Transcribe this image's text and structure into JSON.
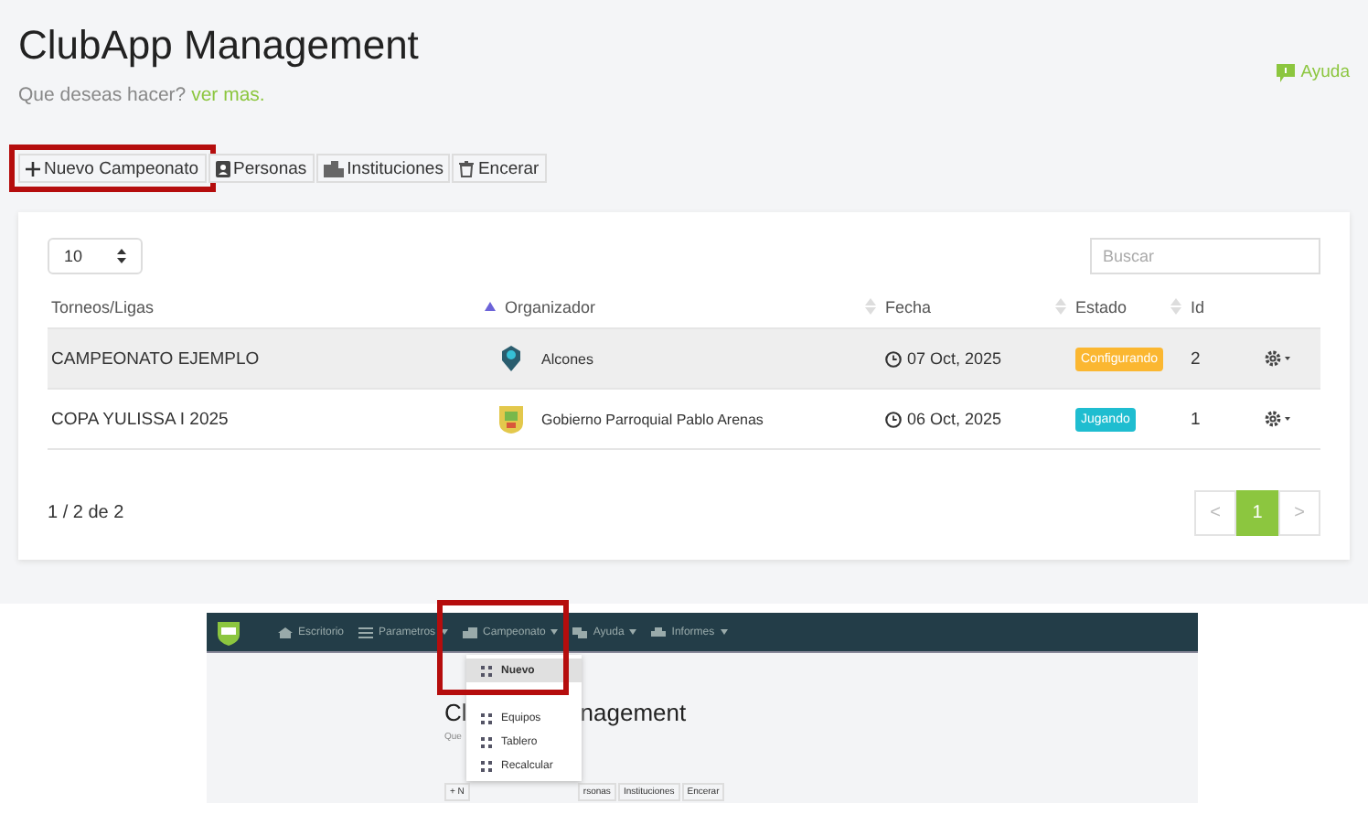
{
  "header": {
    "title": "ClubApp Management",
    "subtitle": "Que deseas hacer?",
    "subtitle_link": "ver mas.",
    "help_link": "Ayuda"
  },
  "toolbar": [
    {
      "label": "Nuevo Campeonato",
      "highlighted": true
    },
    {
      "label": "Personas",
      "highlighted": false
    },
    {
      "label": "Instituciones",
      "highlighted": false
    },
    {
      "label": "Encerar",
      "highlighted": false
    }
  ],
  "table": {
    "page_size": "10",
    "search_placeholder": "Buscar",
    "columns": [
      {
        "label": "Torneos/Ligas",
        "sortable": false
      },
      {
        "label": "Organizador",
        "sortable": true,
        "sorted": true
      },
      {
        "label": "Fecha",
        "sortable": true,
        "sorted": false
      },
      {
        "label": "Estado",
        "sortable": true,
        "sorted": false
      },
      {
        "label": "Id",
        "sortable": true,
        "sorted": false
      }
    ],
    "rows": [
      {
        "name": "CAMPEONATO EJEMPLO",
        "organizer": "Alcones",
        "date": "07 Oct, 2025",
        "status": {
          "label": "Configurando",
          "color": "#fbb731"
        },
        "id": "2",
        "hovered": true
      },
      {
        "name": "COPA YULISSA I 2025",
        "organizer": "Gobierno Parroquial Pablo Arenas",
        "date": "06 Oct, 2025",
        "status": {
          "label": "Jugando",
          "color": "#1fbdd0"
        },
        "id": "1",
        "hovered": false
      }
    ],
    "summary": "1 / 2 de 2",
    "pagination": {
      "prev": "<",
      "pages": [
        {
          "label": "1",
          "selected": true
        }
      ],
      "next": ">"
    }
  },
  "preview": {
    "nav": [
      {
        "label": "Escritorio",
        "caret": false,
        "highlighted": false
      },
      {
        "label": "Parametros",
        "caret": true,
        "highlighted": false
      },
      {
        "label": "Campeonato",
        "caret": true,
        "highlighted": true
      },
      {
        "label": "Ayuda",
        "caret": true,
        "highlighted": false
      },
      {
        "label": "Informes",
        "caret": true,
        "highlighted": false
      }
    ],
    "menu": [
      {
        "label": "Nuevo",
        "selected": true
      },
      {
        "label": "Equipos",
        "selected": false
      },
      {
        "label": "Tablero",
        "selected": false
      },
      {
        "label": "Recalcular",
        "selected": false
      }
    ],
    "title_parts": [
      "Cl",
      "nagement"
    ],
    "subtitle_part": "Que",
    "button_parts": [
      "+ N",
      "rsonas",
      "Instituciones",
      "Encerar"
    ]
  }
}
